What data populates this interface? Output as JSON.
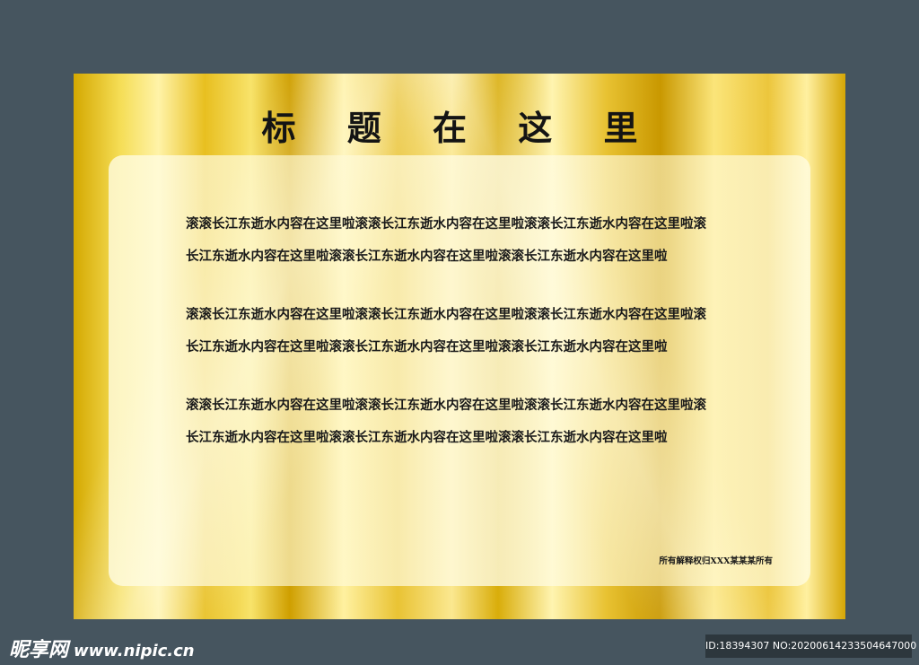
{
  "board": {
    "title": "标 题 在 这 里",
    "paragraphs": [
      {
        "line1": "滚滚长江东逝水内容在这里啦滚滚长江东逝水内容在这里啦滚滚长江东逝水内容在这里啦滚",
        "line2": "长江东逝水内容在这里啦滚滚长江东逝水内容在这里啦滚滚长江东逝水内容在这里啦"
      },
      {
        "line1": "滚滚长江东逝水内容在这里啦滚滚长江东逝水内容在这里啦滚滚长江东逝水内容在这里啦滚",
        "line2": "长江东逝水内容在这里啦滚滚长江东逝水内容在这里啦滚滚长江东逝水内容在这里啦"
      },
      {
        "line1": "滚滚长江东逝水内容在这里啦滚滚长江东逝水内容在这里啦滚滚长江东逝水内容在这里啦滚",
        "line2": "长江东逝水内容在这里啦滚滚长江东逝水内容在这里啦滚滚长江东逝水内容在这里啦"
      }
    ],
    "footer": "所有解释权归XXX某某某所有"
  },
  "watermark": {
    "logo": "昵享网",
    "url": "www.nipic.cn",
    "id_text": "ID:18394307 NO:20200614233504647000"
  },
  "colors": {
    "background": "#46555f",
    "gold": "#e8c232",
    "text": "#141414"
  }
}
